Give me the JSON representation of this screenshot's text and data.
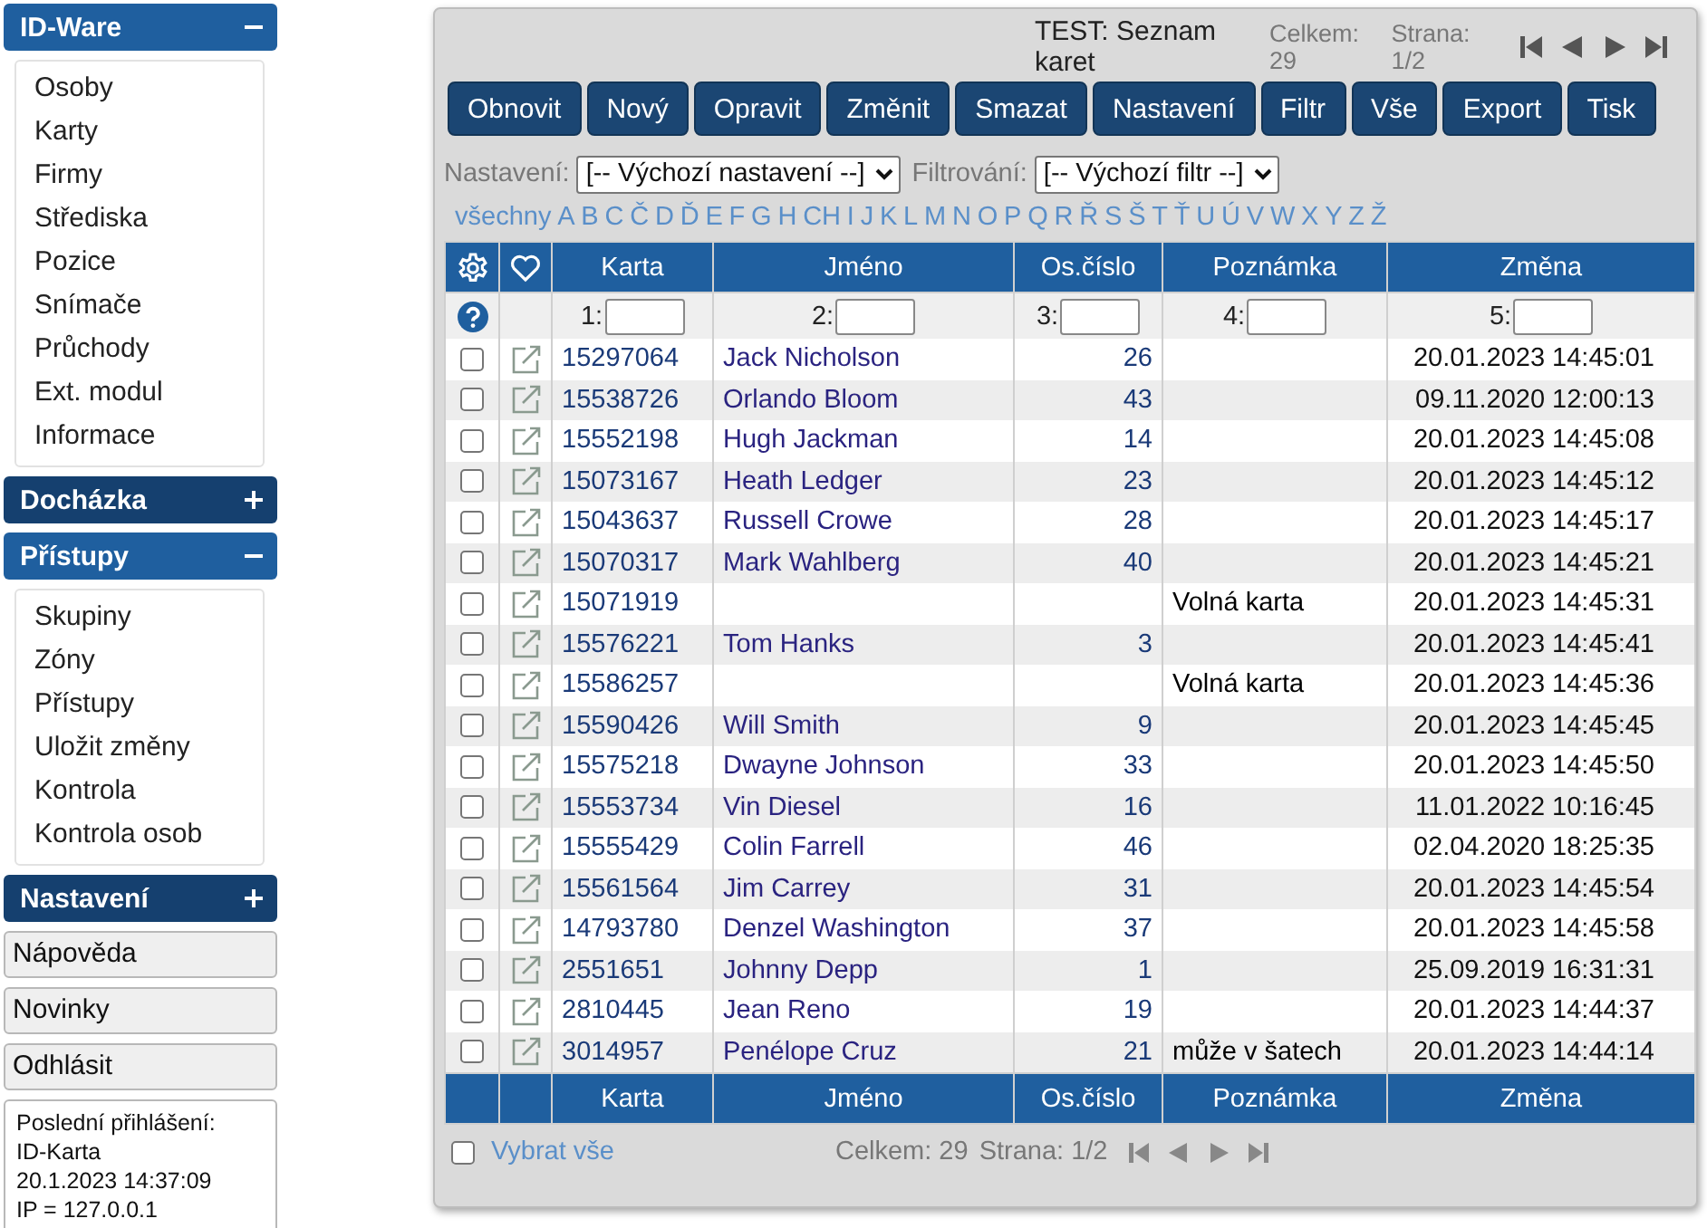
{
  "sidebar": {
    "groups": [
      {
        "title": "ID-Ware",
        "expanded": true,
        "items": [
          "Osoby",
          "Karty",
          "Firmy",
          "Střediska",
          "Pozice",
          "Snímače",
          "Průchody",
          "Ext. modul",
          "Informace"
        ]
      },
      {
        "title": "Docházka",
        "expanded": false
      },
      {
        "title": "Přístupy",
        "expanded": true,
        "items": [
          "Skupiny",
          "Zóny",
          "Přístupy",
          "Uložit změny",
          "Kontrola",
          "Kontrola osob"
        ]
      },
      {
        "title": "Nastavení",
        "expanded": false
      }
    ],
    "links": [
      "Nápověda",
      "Novinky",
      "Odhlásit"
    ],
    "login_info": [
      "Poslední přihlášení:",
      "ID-Karta",
      "20.1.2023 14:37:09",
      "IP = 127.0.0.1"
    ]
  },
  "panel": {
    "title": "TEST: Seznam karet",
    "total": "Celkem: 29",
    "page": "Strana: 1/2",
    "toolbar": [
      "Obnovit",
      "Nový",
      "Opravit",
      "Změnit",
      "Smazat",
      "Nastavení",
      "Filtr",
      "Vše",
      "Export",
      "Tisk"
    ],
    "settings_label": "Nastavení:",
    "settings_select": "[-- Výchozí nastavení --]",
    "filter_label": "Filtrování:",
    "filter_select": "[-- Výchozí filtr --]",
    "letters": [
      "všechny",
      "A",
      "B",
      "C",
      "Č",
      "D",
      "Ď",
      "E",
      "F",
      "G",
      "H",
      "CH",
      "I",
      "J",
      "K",
      "L",
      "M",
      "N",
      "O",
      "P",
      "Q",
      "R",
      "Ř",
      "S",
      "Š",
      "T",
      "Ť",
      "U",
      "Ú",
      "V",
      "W",
      "X",
      "Y",
      "Z",
      "Ž"
    ],
    "table": {
      "columns": [
        "Karta",
        "Jméno",
        "Os.číslo",
        "Poznámka",
        "Změna"
      ],
      "filter_labels": [
        "1:",
        "2:",
        "3:",
        "4:",
        "5:"
      ],
      "rows": [
        {
          "checked": false,
          "card": "15297064",
          "name": "Jack Nicholson",
          "number": "26",
          "changed": "20.01.2023 14:45:01"
        },
        {
          "checked": false,
          "card": "15538726",
          "name": "Orlando Bloom",
          "number": "43",
          "changed": "09.11.2020 12:00:13"
        },
        {
          "checked": false,
          "card": "15552198",
          "name": "Hugh Jackman",
          "number": "14",
          "changed": "20.01.2023 14:45:08"
        },
        {
          "checked": false,
          "card": "15073167",
          "name": "Heath Ledger",
          "number": "23",
          "changed": "20.01.2023 14:45:12"
        },
        {
          "checked": false,
          "card": "15043637",
          "name": "Russell Crowe",
          "number": "28",
          "changed": "20.01.2023 14:45:17"
        },
        {
          "checked": false,
          "card": "15070317",
          "name": "Mark Wahlberg",
          "number": "40",
          "changed": "20.01.2023 14:45:21"
        },
        {
          "checked": false,
          "card": "15071919",
          "note": "Volná karta",
          "changed": "20.01.2023 14:45:31"
        },
        {
          "checked": false,
          "card": "15576221",
          "name": "Tom Hanks",
          "number": "3",
          "changed": "20.01.2023 14:45:41"
        },
        {
          "checked": false,
          "card": "15586257",
          "note": "Volná karta",
          "changed": "20.01.2023 14:45:36"
        },
        {
          "checked": false,
          "card": "15590426",
          "name": "Will Smith",
          "number": "9",
          "changed": "20.01.2023 14:45:45"
        },
        {
          "checked": false,
          "card": "15575218",
          "name": "Dwayne Johnson",
          "number": "33",
          "changed": "20.01.2023 14:45:50"
        },
        {
          "checked": false,
          "card": "15553734",
          "name": "Vin Diesel",
          "number": "16",
          "changed": "11.01.2022 10:16:45"
        },
        {
          "checked": false,
          "card": "15555429",
          "name": "Colin Farrell",
          "number": "46",
          "changed": "02.04.2020 18:25:35"
        },
        {
          "checked": false,
          "card": "15561564",
          "name": "Jim Carrey",
          "number": "31",
          "changed": "20.01.2023 14:45:54"
        },
        {
          "checked": false,
          "card": "14793780",
          "name": "Denzel Washington",
          "number": "37",
          "changed": "20.01.2023 14:45:58"
        },
        {
          "checked": false,
          "card": "2551651",
          "name": "Johnny Depp",
          "number": "1",
          "changed": "25.09.2019 16:31:31"
        },
        {
          "checked": false,
          "card": "2810445",
          "name": "Jean Reno",
          "number": "19",
          "changed": "20.01.2023 14:44:37"
        },
        {
          "checked": false,
          "card": "3014957",
          "name": "Penélope Cruz",
          "number": "21",
          "note": "může v šatech",
          "changed": "20.01.2023 14:44:14"
        }
      ],
      "footer_columns": [
        "Karta",
        "Jméno",
        "Os.číslo",
        "Poznámka",
        "Změna"
      ]
    },
    "select_all": {
      "label": "Vybrat vše",
      "checked": false
    },
    "footer_total": "Celkem: 29",
    "footer_page": "Strana: 1/2"
  }
}
